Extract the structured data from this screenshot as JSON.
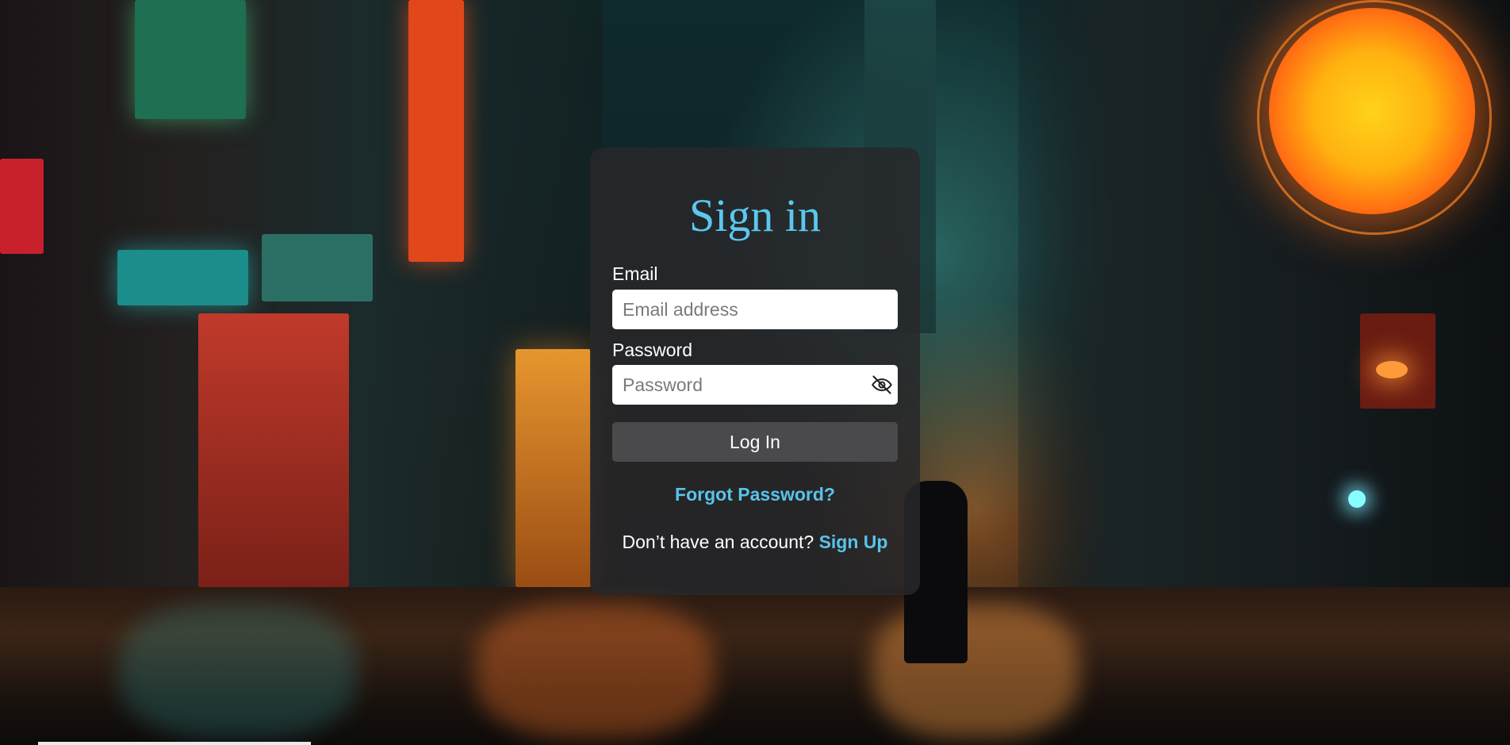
{
  "login": {
    "title": "Sign in",
    "email_label": "Email",
    "email_placeholder": "Email address",
    "email_value": "",
    "password_label": "Password",
    "password_placeholder": "Password",
    "password_value": "",
    "login_button": "Log In",
    "forgot_password": "Forgot Password?",
    "signup_prompt": "Don’t have an account?",
    "signup_link": "Sign Up",
    "password_visibility_icon": "eye-off-icon"
  },
  "colors": {
    "accent": "#5cc7ee",
    "card_bg": "rgba(40,40,42,0.86)",
    "button_bg": "#4a4a4c",
    "text": "#ffffff"
  }
}
